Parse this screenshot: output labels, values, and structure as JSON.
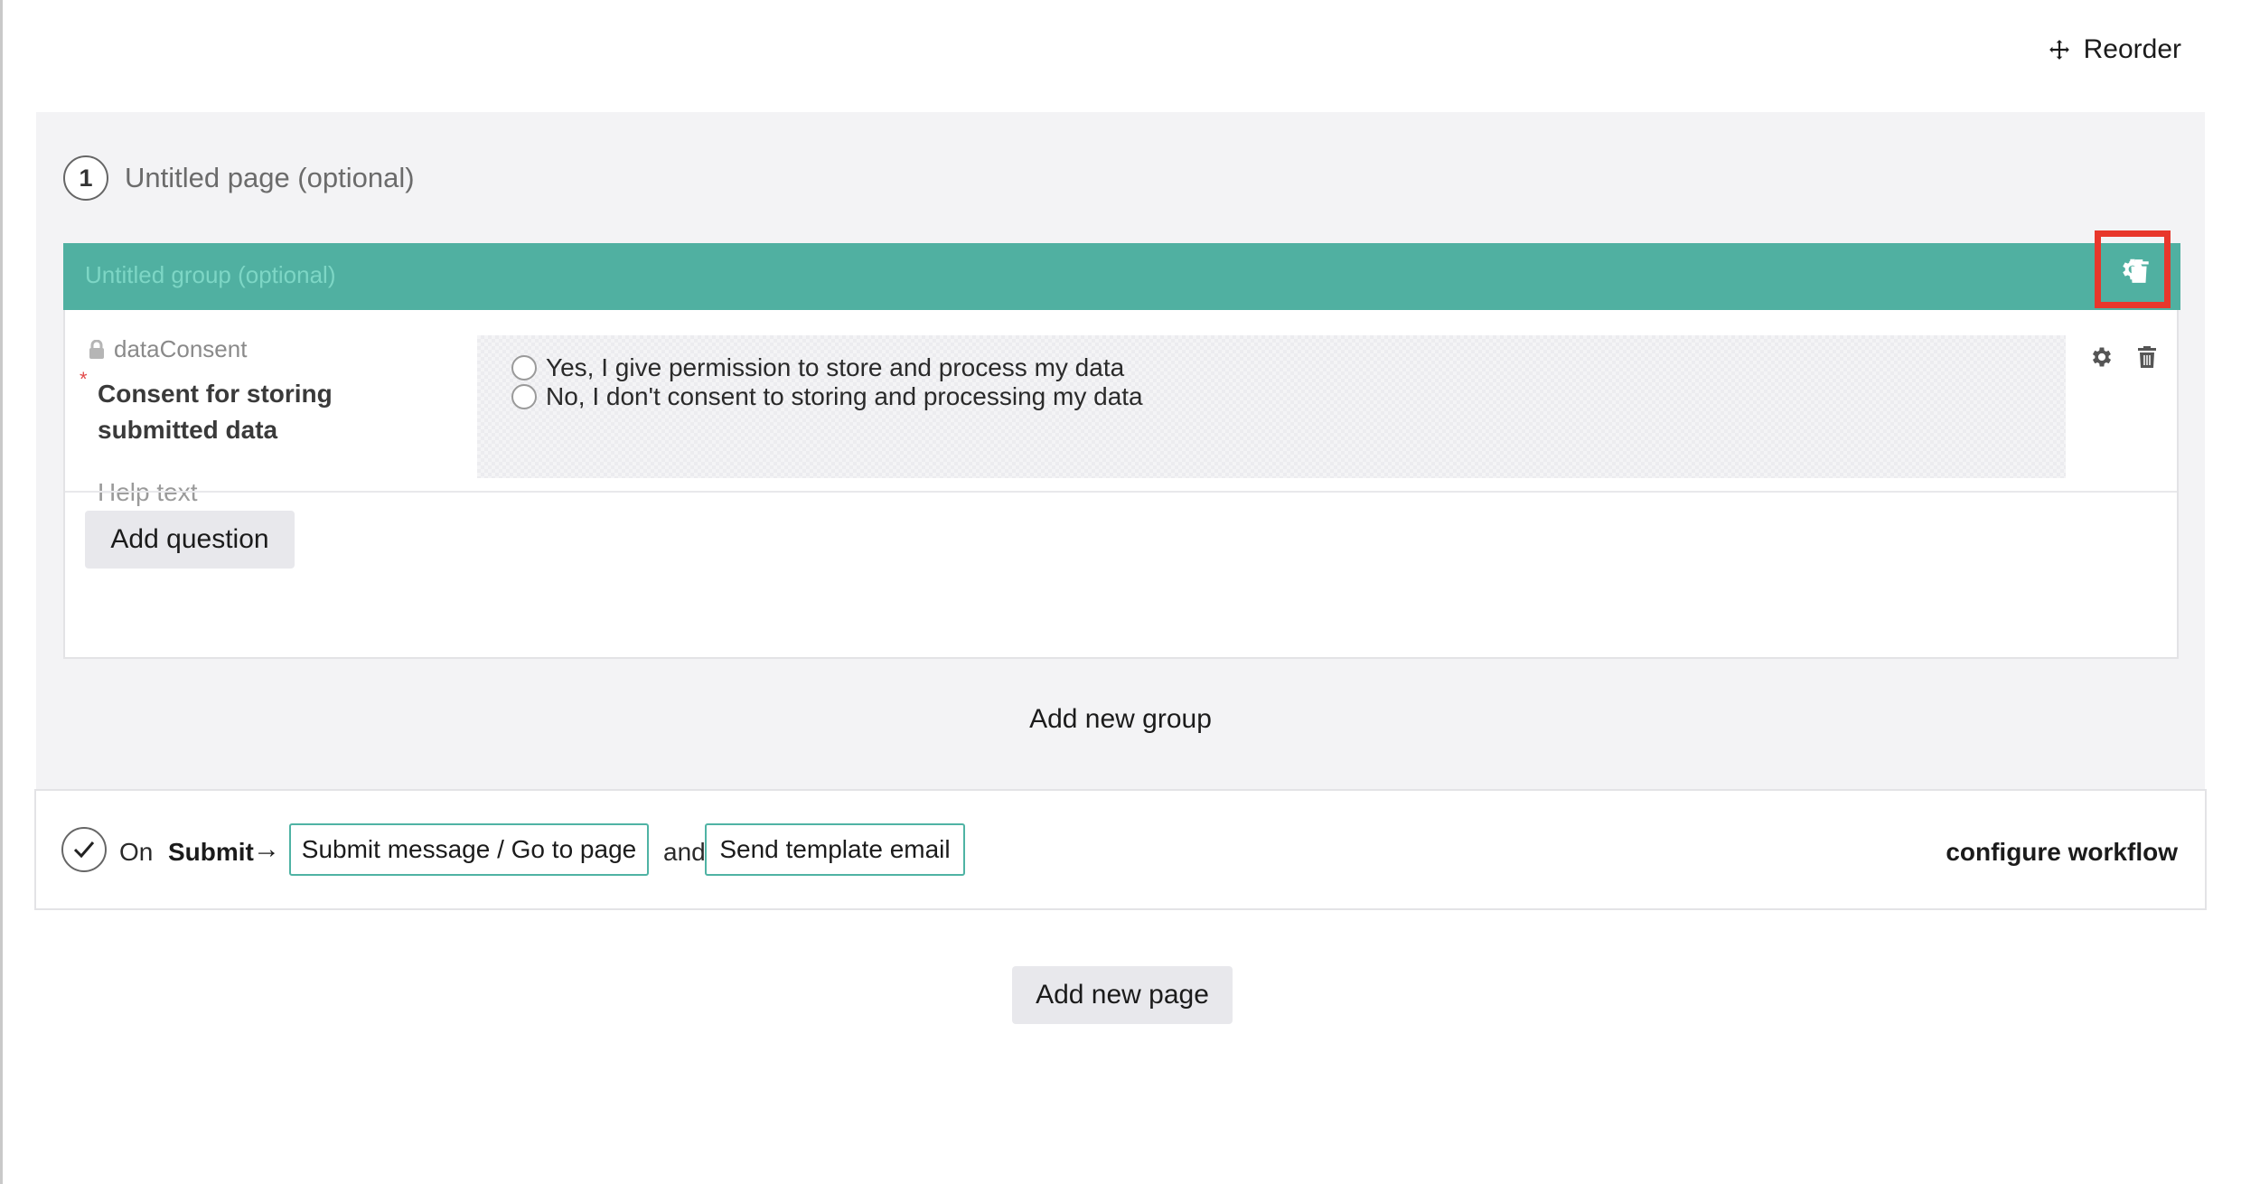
{
  "toolbar": {
    "reorder_label": "Reorder"
  },
  "page": {
    "number": "1",
    "title": "Untitled page (optional)",
    "group": {
      "title": "Untitled group (optional)",
      "question": {
        "key": "dataConsent",
        "required_marker": "*",
        "label": "Consent for storing submitted data",
        "help_text": "Help text",
        "options": [
          "Yes, I give permission to store and process my data",
          "No, I don't consent to storing and processing my data"
        ]
      },
      "add_question_label": "Add question"
    },
    "add_group_label": "Add new group",
    "workflow": {
      "on_label": "On",
      "trigger": "Submit",
      "arrow": "→",
      "action_1": "Submit message / Go to page",
      "and_label": "and",
      "action_2": "Send template email",
      "configure_label": "configure workflow"
    }
  },
  "add_page_label": "Add new page",
  "colors": {
    "group_header": "#50b0a1",
    "highlight": "#e8372b",
    "tag_border": "#4fb3a4"
  }
}
